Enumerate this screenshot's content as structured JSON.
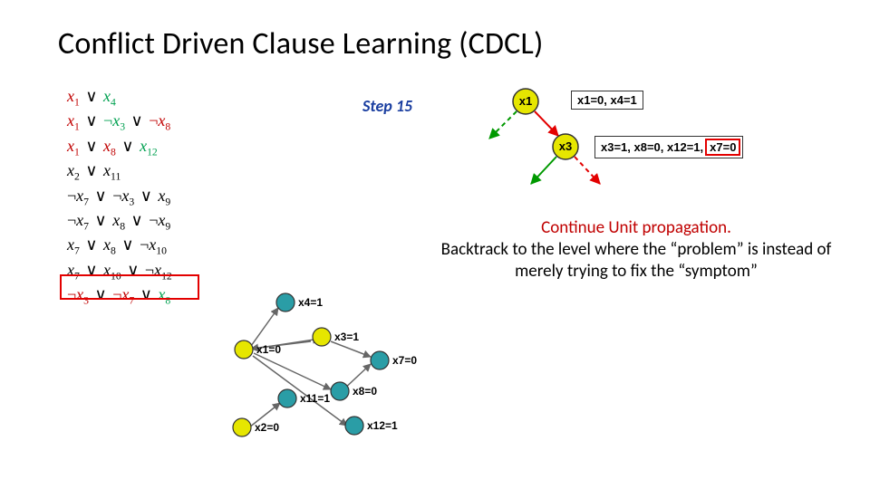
{
  "title": "Conflict Driven Clause Learning (CDCL)",
  "step_label": "Step 15",
  "caption_line1": "Continue Unit propagation.",
  "caption_rest": "Backtrack to the level where the “problem” is instead of merely trying to fix the “symptom”",
  "clauses": [
    [
      {
        "c": "v",
        "t": "x1"
      },
      {
        "t": " ∨ "
      },
      {
        "c": "g",
        "t": "x4"
      }
    ],
    [
      {
        "c": "v",
        "t": "x1"
      },
      {
        "t": " ∨ "
      },
      {
        "c": "g",
        "n": true,
        "t": "x3"
      },
      {
        "t": " ∨ "
      },
      {
        "c": "v",
        "n": true,
        "t": "x8"
      }
    ],
    [
      {
        "c": "v",
        "t": "x1"
      },
      {
        "t": " ∨ "
      },
      {
        "c": "v",
        "t": "x8"
      },
      {
        "t": " ∨ "
      },
      {
        "c": "g",
        "t": "x12"
      }
    ],
    [
      {
        "c": "k",
        "t": "x2"
      },
      {
        "t": " ∨ "
      },
      {
        "c": "k",
        "t": "x11"
      }
    ],
    [
      {
        "c": "k",
        "n": true,
        "t": "x7"
      },
      {
        "t": " ∨ "
      },
      {
        "c": "k",
        "n": true,
        "t": "x3"
      },
      {
        "t": " ∨ "
      },
      {
        "c": "k",
        "t": "x9"
      }
    ],
    [
      {
        "c": "k",
        "n": true,
        "t": "x7"
      },
      {
        "t": " ∨ "
      },
      {
        "c": "k",
        "t": "x8"
      },
      {
        "t": " ∨ "
      },
      {
        "c": "k",
        "n": true,
        "t": "x9"
      }
    ],
    [
      {
        "c": "k",
        "t": "x7"
      },
      {
        "t": " ∨ "
      },
      {
        "c": "k",
        "t": "x8"
      },
      {
        "t": " ∨ "
      },
      {
        "c": "k",
        "n": true,
        "t": "x10"
      }
    ],
    [
      {
        "c": "k",
        "t": "x7"
      },
      {
        "t": " ∨ "
      },
      {
        "c": "k",
        "t": "x10"
      },
      {
        "t": " ∨ "
      },
      {
        "c": "k",
        "n": true,
        "t": "x12"
      }
    ],
    [
      {
        "c": "v",
        "n": true,
        "t": "x3"
      },
      {
        "t": " ∨ "
      },
      {
        "c": "v",
        "n": true,
        "t": "x7"
      },
      {
        "t": " ∨ "
      },
      {
        "c": "g",
        "t": "x8"
      }
    ]
  ],
  "tree": {
    "nodes": {
      "x1": "x1",
      "x3": "x3"
    },
    "box1": "x1=0, x4=1",
    "box2_a": "x3=1, x8=0, x12=1,",
    "box2_b": "x7=0"
  },
  "graph_labels": {
    "x1": "x1=0",
    "x4": "x4=1",
    "x3": "x3=1",
    "x2": "x2=0",
    "x11": "x11=1",
    "x8": "x8=0",
    "x7": "x7=0",
    "x12": "x12=1"
  },
  "colors": {
    "yellow": "#e6e600",
    "teal": "#2a9da6",
    "node_stroke": "#333",
    "edge": "#666",
    "green": "#009900",
    "red": "#e30000"
  }
}
